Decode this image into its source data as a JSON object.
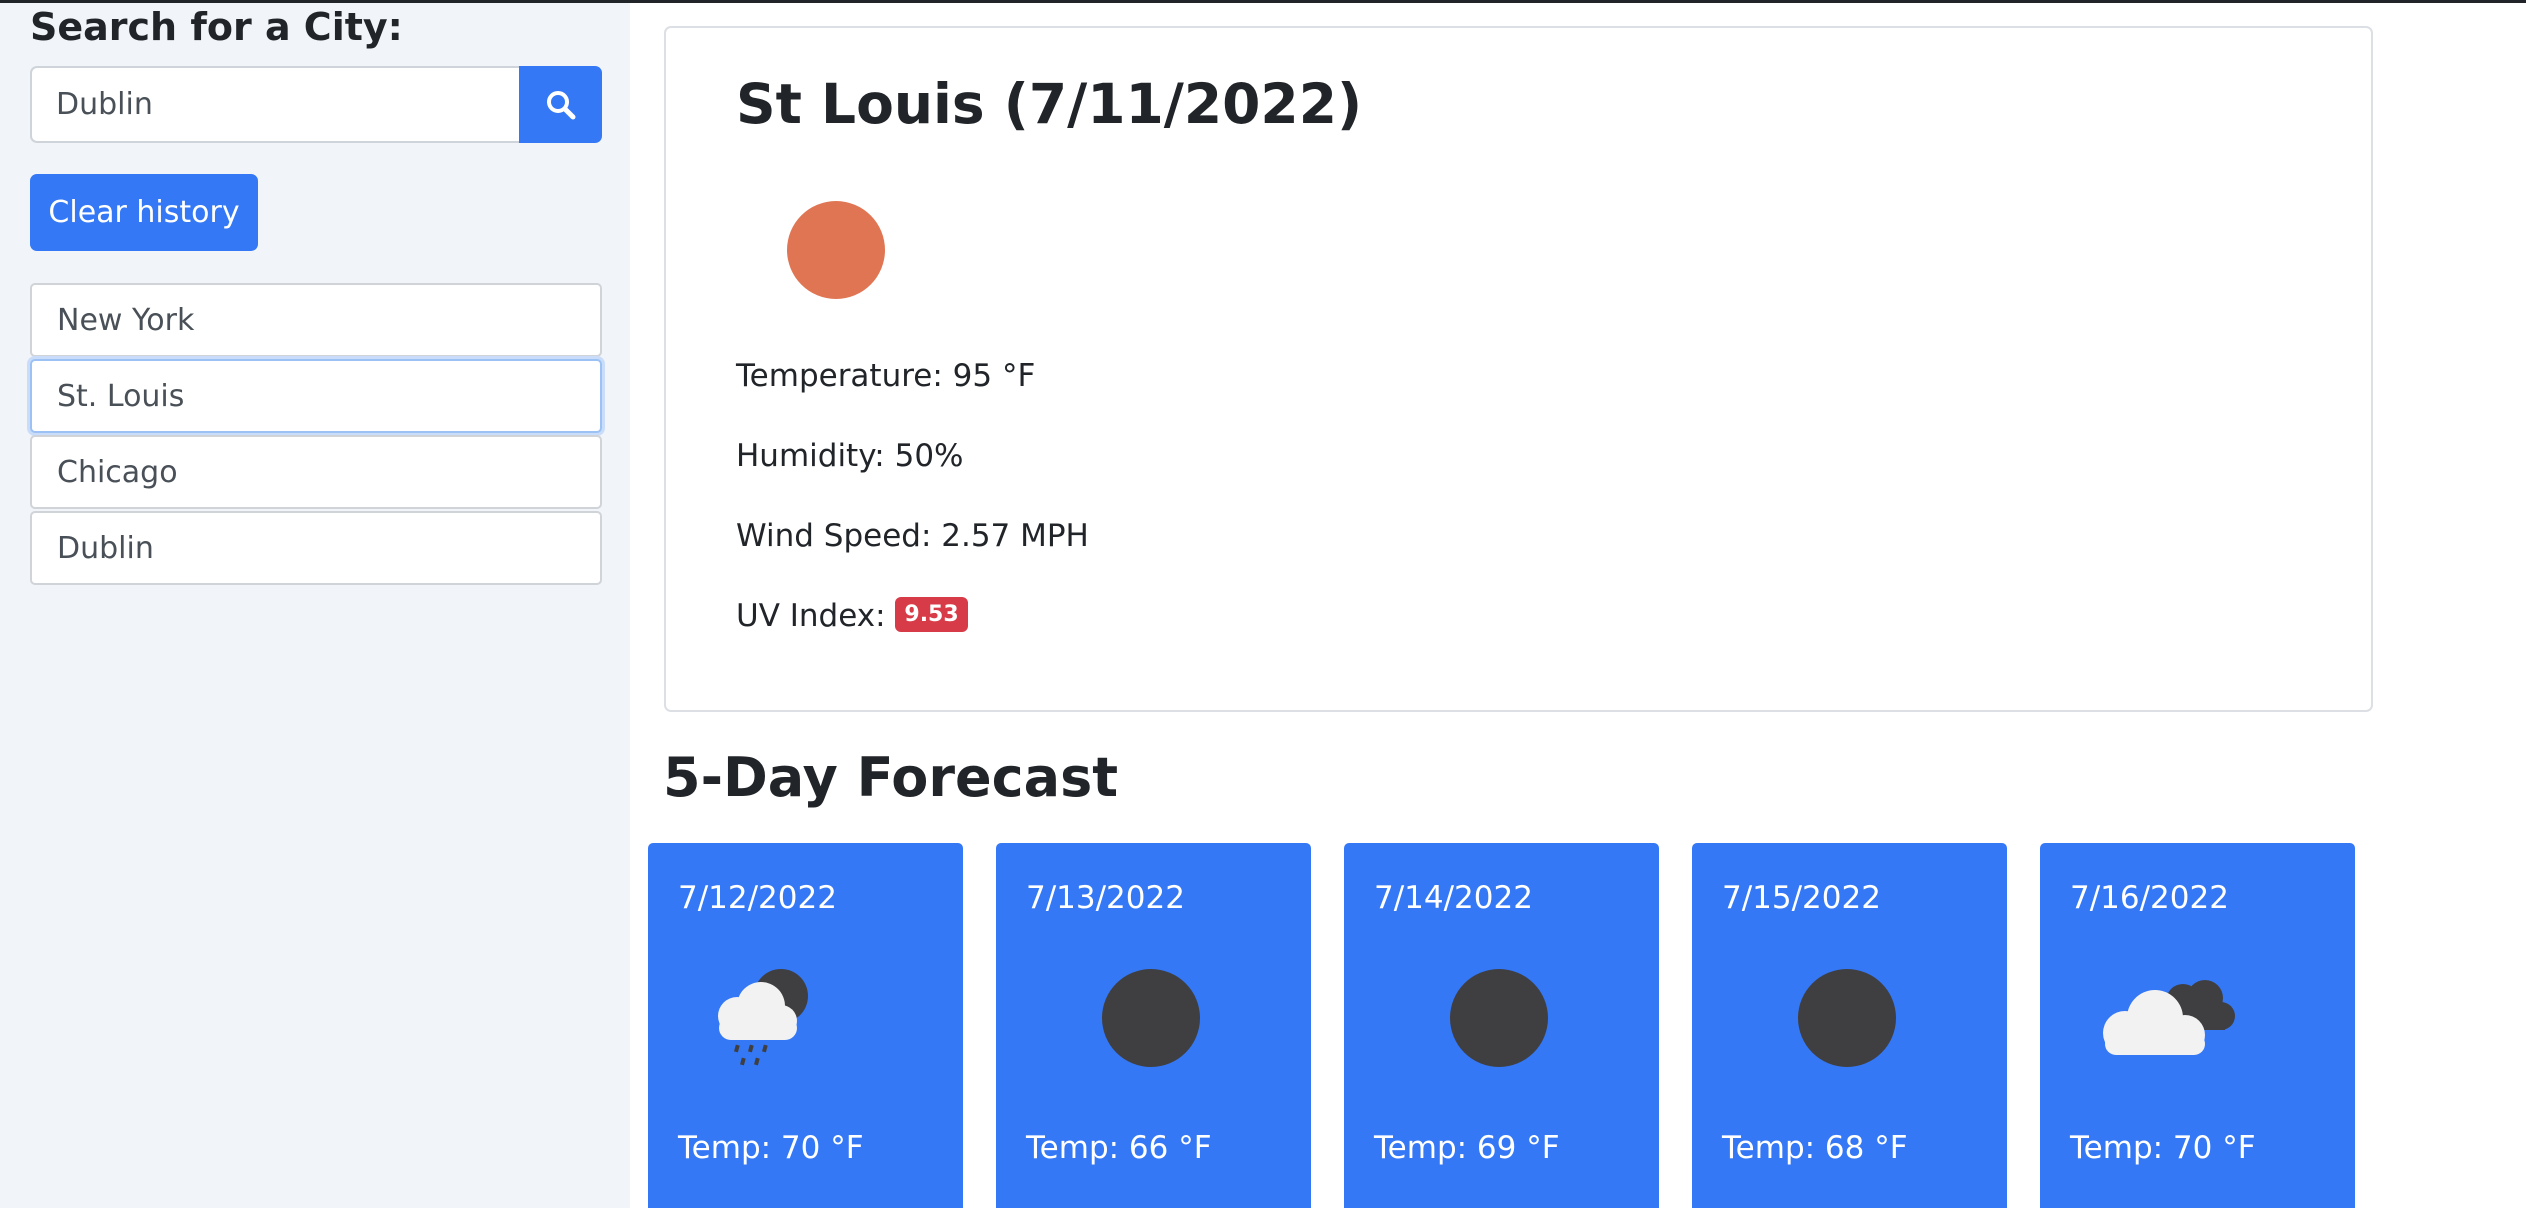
{
  "sidebar": {
    "title": "Search for a City:",
    "search": {
      "value": "Dublin",
      "placeholder": ""
    },
    "search_button_icon": "search-icon",
    "clear_label": "Clear history",
    "history": [
      "New York",
      "St. Louis",
      "Chicago",
      "Dublin"
    ],
    "active_index": 1
  },
  "current": {
    "title": "St Louis (7/11/2022)",
    "icon": "sun-icon",
    "temperature": "Temperature: 95 °F",
    "humidity": "Humidity: 50%",
    "wind": "Wind Speed: 2.57 MPH",
    "uv_label": "UV Index: ",
    "uv_value": "9.53"
  },
  "forecast": {
    "title": "5-Day Forecast",
    "days": [
      {
        "date": "7/12/2022",
        "icon": "rain-cloud-icon",
        "temp": "Temp: 70 °F"
      },
      {
        "date": "7/13/2022",
        "icon": "moon-icon",
        "temp": "Temp: 66 °F"
      },
      {
        "date": "7/14/2022",
        "icon": "moon-icon",
        "temp": "Temp: 69 °F"
      },
      {
        "date": "7/15/2022",
        "icon": "moon-icon",
        "temp": "Temp: 68 °F"
      },
      {
        "date": "7/16/2022",
        "icon": "cloudy-icon",
        "temp": "Temp: 70 °F"
      }
    ]
  },
  "colors": {
    "accent": "#3478f6",
    "sidebar_bg": "#f1f4f8",
    "uv_badge": "#d63b47",
    "sun": "#e07553",
    "night": "#3f3f41"
  }
}
